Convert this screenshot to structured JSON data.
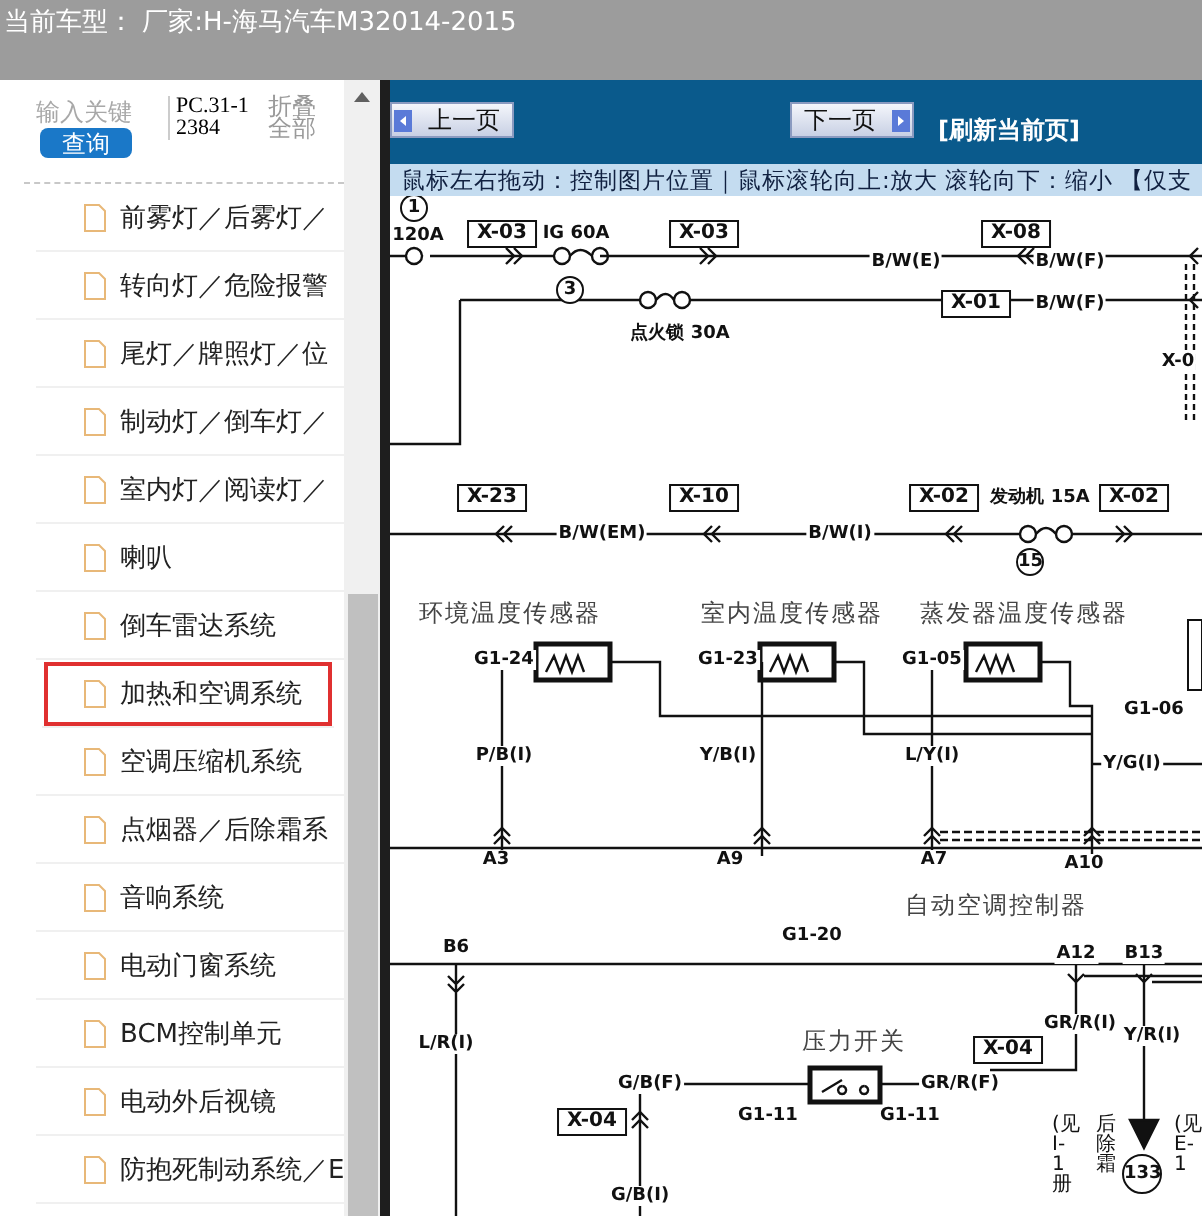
{
  "header": {
    "title": "当前车型：  厂家:H-海马汽车M32014-2015"
  },
  "sidebar": {
    "search": {
      "placeholder": "输入关键",
      "button": "查询"
    },
    "code": "PC.31-12384",
    "collapse": "折叠全部",
    "items": [
      {
        "label": "前雾灯／后雾灯／",
        "selected": false
      },
      {
        "label": "转向灯／危险报警",
        "selected": false
      },
      {
        "label": "尾灯／牌照灯／位",
        "selected": false
      },
      {
        "label": "制动灯／倒车灯／",
        "selected": false
      },
      {
        "label": "室内灯／阅读灯／",
        "selected": false
      },
      {
        "label": "喇叭",
        "selected": false
      },
      {
        "label": "倒车雷达系统",
        "selected": false
      },
      {
        "label": "加热和空调系统",
        "selected": true
      },
      {
        "label": "空调压缩机系统",
        "selected": false
      },
      {
        "label": "点烟器／后除霜系",
        "selected": false
      },
      {
        "label": "音响系统",
        "selected": false
      },
      {
        "label": "电动门窗系统",
        "selected": false
      },
      {
        "label": "BCM控制单元",
        "selected": false
      },
      {
        "label": "电动外后视镜",
        "selected": false
      },
      {
        "label": "防抱死制动系统／E",
        "selected": false
      }
    ]
  },
  "viewer": {
    "prev": "上一页",
    "next": "下一页",
    "refresh": "[刷新当前页]",
    "hint": "鼠标左右拖动：控制图片位置｜鼠标滚轮向上:放大  滚轮向下：缩小 【仅支",
    "labels": [
      {
        "text": "1",
        "kind": "circle"
      },
      {
        "text": "120A",
        "kind": "plain"
      },
      {
        "text": "X-03",
        "kind": "box"
      },
      {
        "text": "IG 60A",
        "kind": "plain"
      },
      {
        "text": "X-03",
        "kind": "box"
      },
      {
        "text": "3",
        "kind": "circle"
      },
      {
        "text": "X-08",
        "kind": "box"
      },
      {
        "text": "B/W(E)",
        "kind": "plain"
      },
      {
        "text": "B/W(F)",
        "kind": "plain"
      },
      {
        "text": "X-01",
        "kind": "box"
      },
      {
        "text": "B/W(F)",
        "kind": "plain"
      },
      {
        "text": "点火锁 30A",
        "kind": "plain"
      },
      {
        "text": "X-0",
        "kind": "plain"
      },
      {
        "text": "X-23",
        "kind": "box"
      },
      {
        "text": "X-10",
        "kind": "box"
      },
      {
        "text": "X-02",
        "kind": "box"
      },
      {
        "text": "发动机 15A",
        "kind": "plain"
      },
      {
        "text": "X-02",
        "kind": "box"
      },
      {
        "text": "B/W(EM)",
        "kind": "plain"
      },
      {
        "text": "B/W(I)",
        "kind": "plain"
      },
      {
        "text": "15",
        "kind": "circle"
      },
      {
        "text": "环境温度传感器",
        "kind": "title"
      },
      {
        "text": "室内温度传感器",
        "kind": "title"
      },
      {
        "text": "蒸发器温度传感器",
        "kind": "title"
      },
      {
        "text": "G1-24",
        "kind": "plain"
      },
      {
        "text": "G1-23",
        "kind": "plain"
      },
      {
        "text": "G1-05",
        "kind": "plain"
      },
      {
        "text": "G1-06",
        "kind": "plain"
      },
      {
        "text": "P/B(I)",
        "kind": "plain"
      },
      {
        "text": "Y/B(I)",
        "kind": "plain"
      },
      {
        "text": "L/Y(I)",
        "kind": "plain"
      },
      {
        "text": "Y/G(I)",
        "kind": "plain"
      },
      {
        "text": "A3",
        "kind": "plain"
      },
      {
        "text": "A9",
        "kind": "plain"
      },
      {
        "text": "A7",
        "kind": "plain"
      },
      {
        "text": "A10",
        "kind": "plain"
      },
      {
        "text": "自动空调控制器",
        "kind": "title"
      },
      {
        "text": "G1-20",
        "kind": "plain"
      },
      {
        "text": "B6",
        "kind": "plain"
      },
      {
        "text": "A12",
        "kind": "plain"
      },
      {
        "text": "B13",
        "kind": "plain"
      },
      {
        "text": "L/R(I)",
        "kind": "plain"
      },
      {
        "text": "压力开关",
        "kind": "title"
      },
      {
        "text": "X-04",
        "kind": "box"
      },
      {
        "text": "GR/R(I)",
        "kind": "plain"
      },
      {
        "text": "Y/R(I)",
        "kind": "plain"
      },
      {
        "text": "G/B(F)",
        "kind": "plain"
      },
      {
        "text": "GR/R(F)",
        "kind": "plain"
      },
      {
        "text": "X-04",
        "kind": "box"
      },
      {
        "text": "G1-11",
        "kind": "plain"
      },
      {
        "text": "G1-11",
        "kind": "plain"
      },
      {
        "text": "G/B(I)",
        "kind": "plain"
      },
      {
        "text": "133",
        "kind": "circle"
      },
      {
        "text": "(见I-1册",
        "kind": "vertical"
      },
      {
        "text": "后除霜",
        "kind": "vertical"
      },
      {
        "text": "(见E-1",
        "kind": "vertical"
      }
    ]
  }
}
